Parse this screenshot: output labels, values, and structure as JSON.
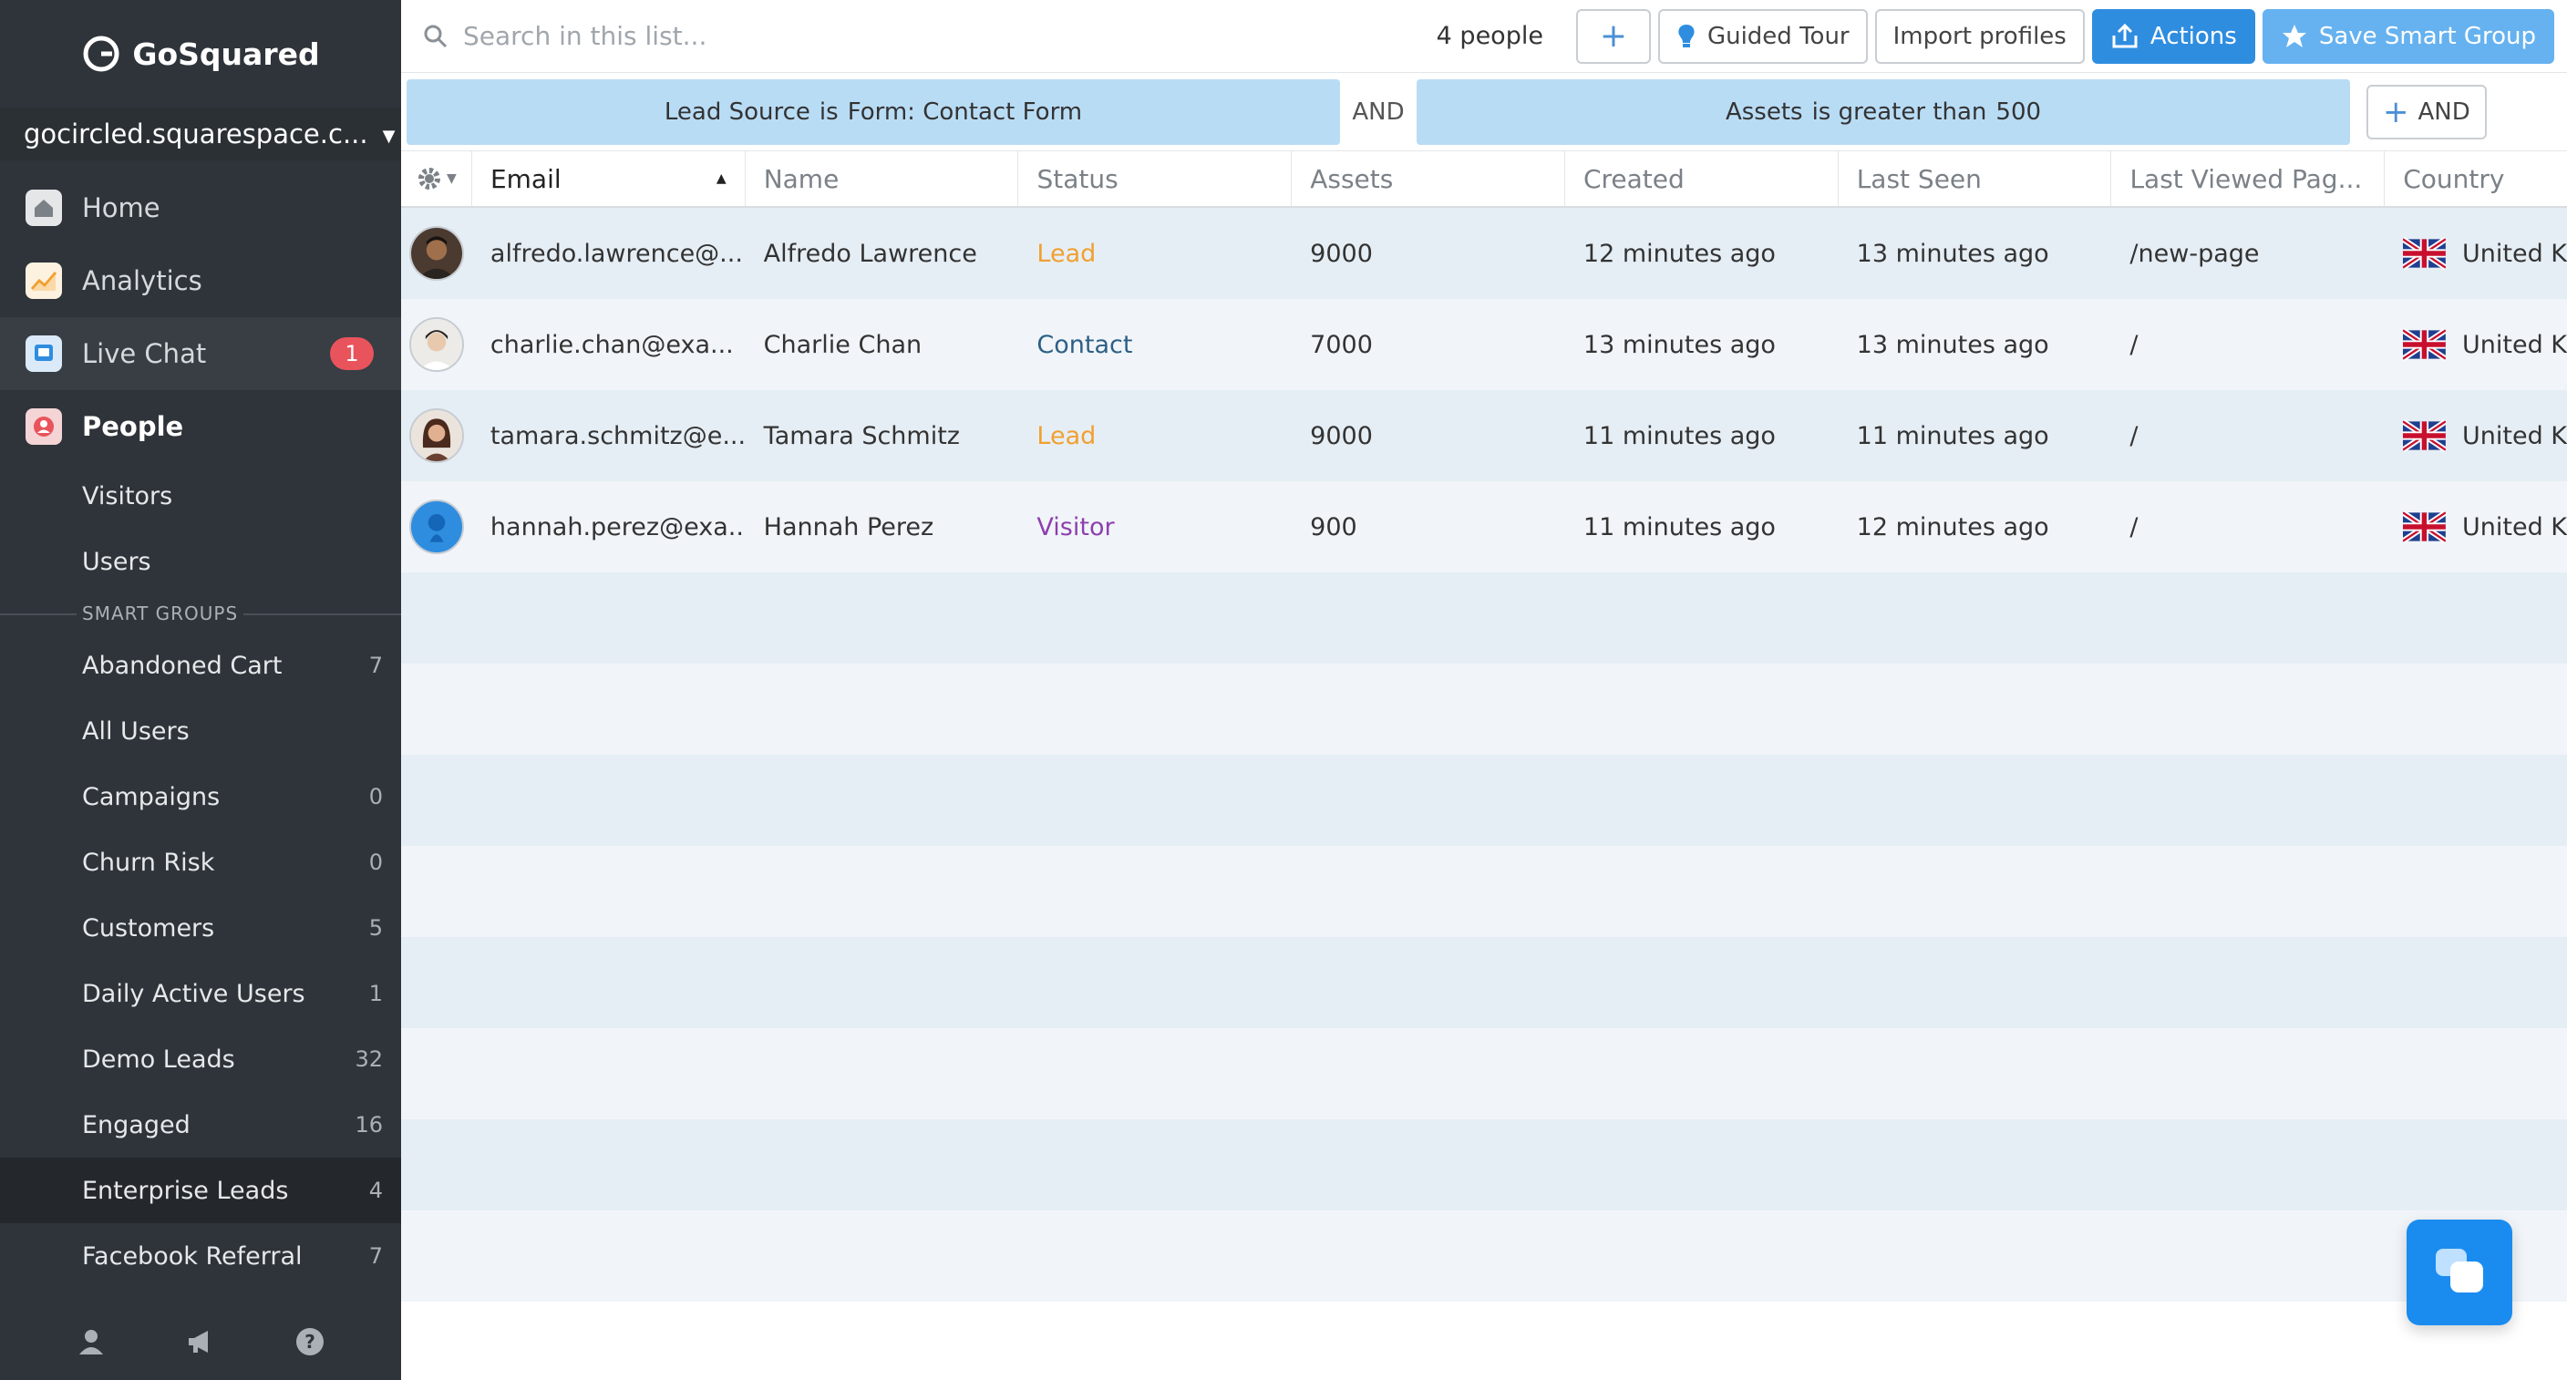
{
  "app": {
    "brand": "GoSquared",
    "site": "gocircled.squarespace.c..."
  },
  "nav": {
    "home": "Home",
    "analytics": "Analytics",
    "livechat": "Live Chat",
    "livechat_badge": "1",
    "people": "People",
    "visitors": "Visitors",
    "users": "Users",
    "smart_groups_label": "SMART GROUPS"
  },
  "groups": [
    {
      "label": "Abandoned Cart",
      "count": "7"
    },
    {
      "label": "All Users",
      "count": ""
    },
    {
      "label": "Campaigns",
      "count": "0"
    },
    {
      "label": "Churn Risk",
      "count": "0"
    },
    {
      "label": "Customers",
      "count": "5"
    },
    {
      "label": "Daily Active Users",
      "count": "1"
    },
    {
      "label": "Demo Leads",
      "count": "32"
    },
    {
      "label": "Engaged",
      "count": "16"
    },
    {
      "label": "Enterprise Leads",
      "count": "4"
    },
    {
      "label": "Facebook Referral",
      "count": "7"
    }
  ],
  "toolbar": {
    "search_placeholder": "Search in this list...",
    "people_count": "4 people",
    "guided_tour": "Guided Tour",
    "import_profiles": "Import profiles",
    "actions": "Actions",
    "save_smart_group": "Save Smart Group"
  },
  "filters": {
    "f1_field": "Lead Source",
    "f1_op": "is",
    "f1_value": "Form: Contact Form",
    "joiner": "AND",
    "f2_field": "Assets",
    "f2_op": "is greater than",
    "f2_value": "500",
    "add_and": "AND"
  },
  "columns": {
    "email": "Email",
    "name": "Name",
    "status": "Status",
    "assets": "Assets",
    "created": "Created",
    "last_seen": "Last Seen",
    "last_viewed": "Last Viewed Pag...",
    "country": "Country"
  },
  "rows": [
    {
      "email": "alfredo.lawrence@...",
      "name": "Alfredo Lawrence",
      "status": "Lead",
      "assets": "9000",
      "created": "12 minutes ago",
      "last_seen": "13 minutes ago",
      "page": "/new-page",
      "country": "United K"
    },
    {
      "email": "charlie.chan@exa...",
      "name": "Charlie Chan",
      "status": "Contact",
      "assets": "7000",
      "created": "13 minutes ago",
      "last_seen": "13 minutes ago",
      "page": "/",
      "country": "United K"
    },
    {
      "email": "tamara.schmitz@e...",
      "name": "Tamara Schmitz",
      "status": "Lead",
      "assets": "9000",
      "created": "11 minutes ago",
      "last_seen": "11 minutes ago",
      "page": "/",
      "country": "United K"
    },
    {
      "email": "hannah.perez@exa...",
      "name": "Hannah Perez",
      "status": "Visitor",
      "assets": "900",
      "created": "11 minutes ago",
      "last_seen": "12 minutes ago",
      "page": "/",
      "country": "United K"
    }
  ],
  "colors": {
    "sidebar": "#2f343a",
    "accent": "#2f8de0",
    "lead": "#f0a030",
    "contact": "#2d5f85",
    "visitor": "#8d3fae",
    "filter_chip": "#b9dcf5"
  }
}
